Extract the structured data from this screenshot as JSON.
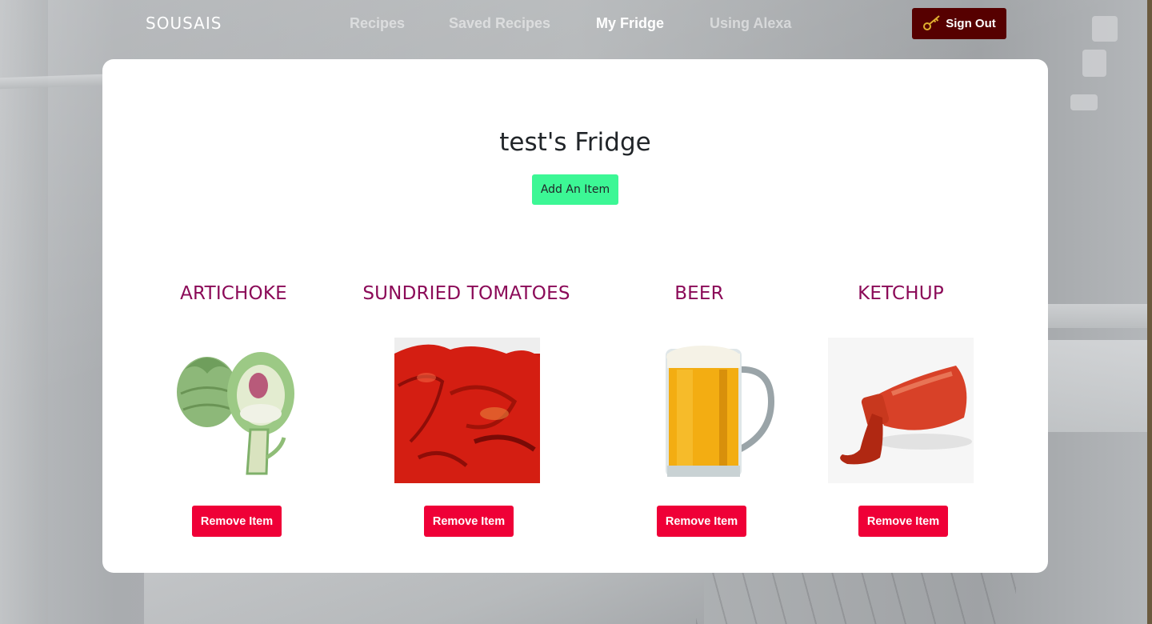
{
  "navbar": {
    "brand": "SOUSAIS",
    "links": [
      {
        "label": "Recipes",
        "active": false
      },
      {
        "label": "Saved Recipes",
        "active": false
      },
      {
        "label": "My Fridge",
        "active": true
      },
      {
        "label": "Using Alexa",
        "active": false
      }
    ],
    "sign_out": {
      "label": "Sign Out",
      "icon": "key-icon"
    }
  },
  "main": {
    "title": "test's Fridge",
    "add_button_label": "Add An Item",
    "items": [
      {
        "name": "ARTICHOKE",
        "image": "artichoke-image",
        "remove_label": "Remove Item"
      },
      {
        "name": "SUNDRIED TOMATOES",
        "image": "sundried-tomatoes-image",
        "remove_label": "Remove Item"
      },
      {
        "name": "BEER",
        "image": "beer-image",
        "remove_label": "Remove Item"
      },
      {
        "name": "KETCHUP",
        "image": "ketchup-image",
        "remove_label": "Remove Item"
      }
    ]
  },
  "colors": {
    "sign_out_bg": "#560000",
    "add_button_bg": "#3cf795",
    "remove_button_bg": "#ef0037",
    "item_title": "#8b0a58",
    "key_icon": "#e0b030"
  }
}
